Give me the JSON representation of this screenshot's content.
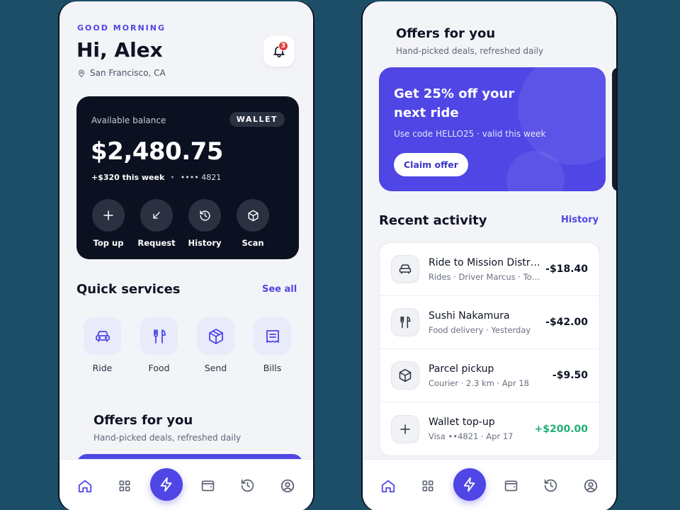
{
  "left": {
    "greeting_small": "GOOD MORNING",
    "greeting": "Hi, Alex",
    "location": "San Francisco, CA",
    "notifications_count": "3",
    "wallet": {
      "available_label": "Available balance",
      "tag": "WALLET",
      "balance": "$2,480.75",
      "weekly_change": "+$320 this week",
      "card_masked": "•••• 4821",
      "actions": [
        {
          "label": "Top up",
          "icon": "plus-icon"
        },
        {
          "label": "Request",
          "icon": "arrow-down-left-icon"
        },
        {
          "label": "History",
          "icon": "history-icon"
        },
        {
          "label": "Scan",
          "icon": "box-icon"
        }
      ]
    },
    "quick_services": {
      "title": "Quick services",
      "see_all": "See all",
      "items": [
        {
          "label": "Ride",
          "icon": "car-icon"
        },
        {
          "label": "Food",
          "icon": "utensils-icon"
        },
        {
          "label": "Send",
          "icon": "package-icon"
        },
        {
          "label": "Bills",
          "icon": "receipt-icon"
        }
      ]
    },
    "offers": {
      "title": "Offers for you",
      "subtitle": "Hand-picked deals, refreshed daily"
    }
  },
  "right": {
    "offers": {
      "title": "Offers for you",
      "subtitle": "Hand-picked deals, refreshed daily",
      "promo": {
        "headline": "Get 25% off your next ride",
        "code_text": "Use code HELLO25 · valid this week",
        "button": "Claim offer"
      }
    },
    "activity": {
      "title": "Recent activity",
      "link": "History",
      "items": [
        {
          "title": "Ride to Mission District",
          "subtitle": "Rides · Driver Marcus · Today",
          "amount": "-$18.40",
          "icon": "car-icon"
        },
        {
          "title": "Sushi Nakamura",
          "subtitle": "Food delivery · Yesterday",
          "amount": "-$42.00",
          "icon": "utensils-icon"
        },
        {
          "title": "Parcel pickup",
          "subtitle": "Courier · 2.3 km · Apr 18",
          "amount": "-$9.50",
          "icon": "package-icon"
        },
        {
          "title": "Wallet top-up",
          "subtitle": "Visa ••4821 · Apr 17",
          "amount": "+$200.00",
          "icon": "plus-icon"
        }
      ]
    }
  },
  "nav": [
    "home-icon",
    "grid-icon",
    "bolt-icon",
    "wallet-icon",
    "history-icon",
    "profile-icon"
  ],
  "colors": {
    "accent": "#4f46e5",
    "dark_card": "#0b1120",
    "positive": "#23b07a",
    "badge": "#e03b3b",
    "background": "#1d4e68"
  }
}
